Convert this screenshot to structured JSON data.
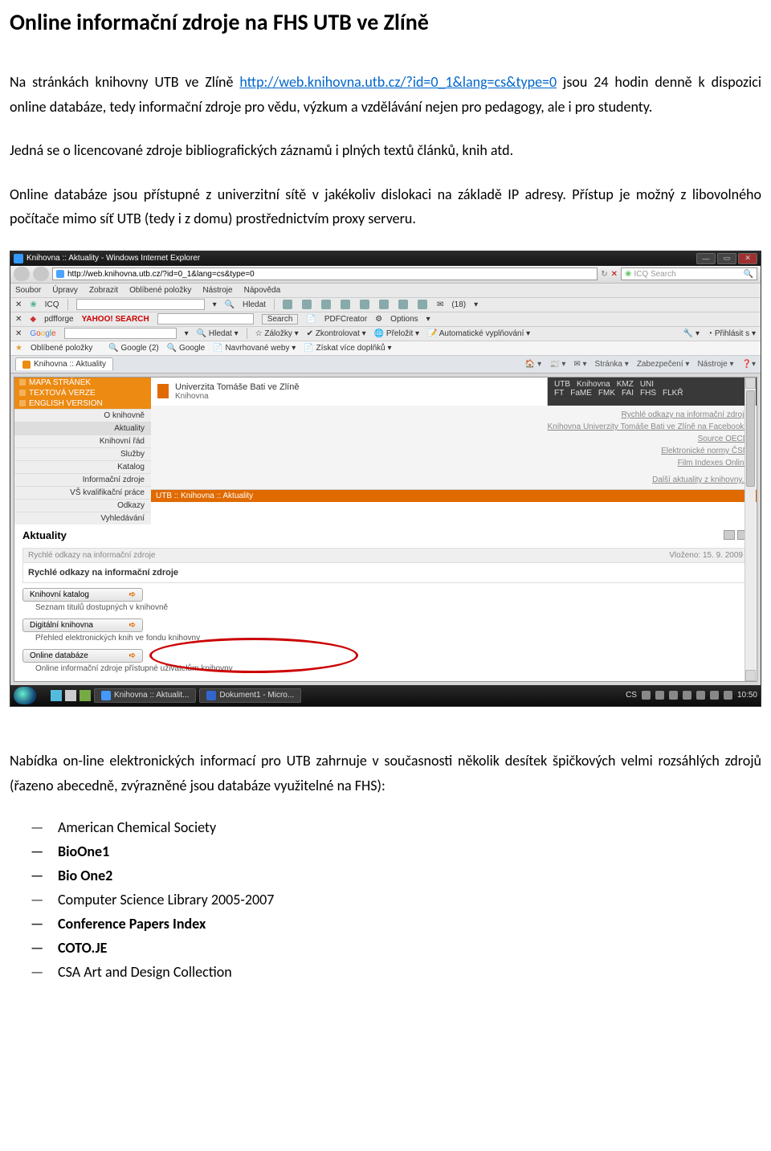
{
  "doc": {
    "title": "Online informační zdroje na FHS UTB ve Zlíně",
    "p1a": "Na stránkách knihovny UTB ve Zlíně ",
    "p1_link_label": "http://web.knihovna.utb.cz/?id=0_1&lang=cs&type=0",
    "p1b": " jsou 24 hodin denně k dispozici online databáze, tedy informační zdroje pro vědu, výzkum a vzdělávání nejen pro pedagogy, ale i pro studenty.",
    "p2": "Jedná se o licencované zdroje bibliografických záznamů i plných textů článků, knih atd.",
    "p3": "Online databáze jsou přístupné z univerzitní sítě v jakékoliv dislokaci na základě IP adresy. Přístup je možný z libovolného počítače mimo síť UTB (tedy i z domu) prostřednictvím proxy serveru.",
    "list_intro": "Nabídka on-line elektronických informací pro UTB zahrnuje v současnosti několik desítek špičkových velmi rozsáhlých zdrojů (řazeno abecedně, zvýrazněné jsou databáze využitelné na FHS):",
    "list": [
      {
        "t": "American Chemical Society",
        "b": false
      },
      {
        "t": "BioOne1",
        "b": true
      },
      {
        "t": "Bio One2",
        "b": true
      },
      {
        "t": "Computer Science Library 2005-2007",
        "b": false
      },
      {
        "t": "Conference Papers Index",
        "b": true
      },
      {
        "t": "COTO.JE",
        "b": true
      },
      {
        "t": "CSA Art and Design Collection",
        "b": false
      }
    ]
  },
  "win": {
    "title": "Knihovna :: Aktuality - Windows Internet Explorer",
    "url": "http://web.knihovna.utb.cz/?id=0_1&lang=cs&type=0",
    "search_placeholder": "ICQ Search",
    "menu": [
      "Soubor",
      "Úpravy",
      "Zobrazit",
      "Oblíbené položky",
      "Nástroje",
      "Nápověda"
    ],
    "tb1_hledat": "Hledat",
    "tb1_badge": "(18)",
    "tb2_yahoo": "YAHOO! SEARCH",
    "tb2_search": "Search",
    "tb2_pdf": "PDFCreator",
    "tb2_options": "Options",
    "tb3_google": "Google",
    "tb3_items": [
      "Hledat",
      "Záložky",
      "Zkontrolovat",
      "Přeložit",
      "Automatické vyplňování"
    ],
    "tb3_right": "Přihlásit s",
    "ob_label": "Oblíbené položky",
    "ob_items": [
      "Google (2)",
      "Google",
      "Navrhované weby",
      "Získat více doplňků"
    ],
    "tab_label": "Knihovna :: Aktuality",
    "tab_right": [
      "Stránka",
      "Zabezpečení",
      "Nástroje"
    ],
    "icq": "ICQ",
    "pdforge": "pdfforge"
  },
  "page": {
    "sb_top": [
      "MAPA STRÁNEK",
      "TEXTOVÁ VERZE",
      "ENGLISH VERSION"
    ],
    "sb_menu": [
      "O knihovně",
      "Aktuality",
      "Knihovní řád",
      "Služby",
      "Katalog",
      "Informační zdroje",
      "VŠ kvalifikační práce",
      "Odkazy",
      "Vyhledávání"
    ],
    "uni": "Univerzita Tomáše Bati ve Zlíně",
    "uni_sub": "Knihovna",
    "top_right1": [
      "UTB",
      "Knihovna",
      "KMZ",
      "UNI"
    ],
    "top_right2": [
      "FT",
      "FaME",
      "FMK",
      "FAI",
      "FHS",
      "FLKŘ"
    ],
    "quick_links": [
      "Rychlé odkazy na informační zdroje",
      "Knihovna Univerzity Tomáše Bati ve Zlíně na Facebooku",
      "Source OECD",
      "Elektronické normy ČSN",
      "Film Indexes Online",
      "Další aktuality z knihovny..."
    ],
    "crumb": "UTB :: Knihovna :: Aktuality",
    "aktuality": "Aktuality",
    "content_head": "Rychlé odkazy na informační zdroje",
    "content_date": "Vloženo: 15. 9. 2009",
    "content_sub": "Rychlé odkazy na informační zdroje",
    "btn1": "Knihovní katalog",
    "btn1_desc": "Seznam titulů dostupných v knihovně",
    "btn2": "Digitální knihovna",
    "btn2_desc": "Přehled elektronických knih ve fondu knihovny",
    "btn3": "Online databáze",
    "btn3_desc": "Online informační zdroje přístupné uživatelům knihovny"
  },
  "taskbar": {
    "tasks": [
      "Knihovna :: Aktualit...",
      "Dokument1 - Micro..."
    ],
    "lang": "CS",
    "time": "10:50"
  }
}
